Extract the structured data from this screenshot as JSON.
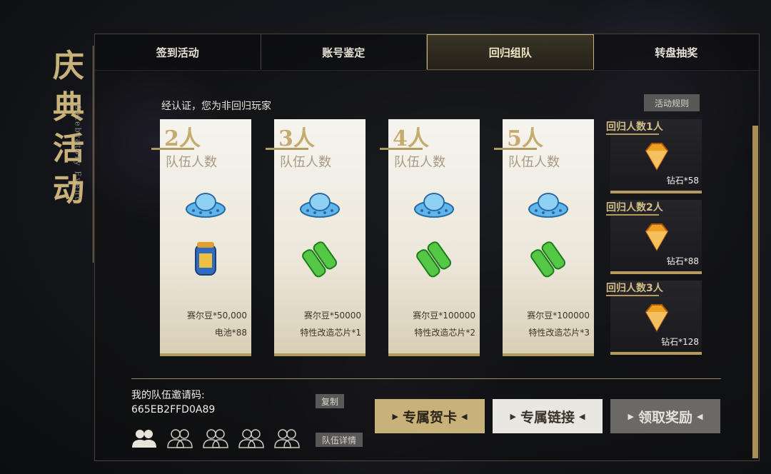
{
  "side_title": {
    "big": "庆典活动",
    "small": "Celebratory Event"
  },
  "tabs": [
    {
      "label": "签到活动"
    },
    {
      "label": "账号鉴定"
    },
    {
      "label": "回归组队"
    },
    {
      "label": "转盘抽奖"
    }
  ],
  "status_text": "经认证，您为非回归玩家",
  "rules_button": "活动规则",
  "cards": [
    {
      "num": "2人",
      "sub": "队伍人数",
      "line1": "赛尔豆*50,000",
      "line2": "电池*88",
      "icon2": "battery-icon"
    },
    {
      "num": "3人",
      "sub": "队伍人数",
      "line1": "赛尔豆*50000",
      "line2": "特性改造芯片*1",
      "icon2": "chip-icon"
    },
    {
      "num": "4人",
      "sub": "队伍人数",
      "line1": "赛尔豆*100000",
      "line2": "特性改造芯片*2",
      "icon2": "chip-icon"
    },
    {
      "num": "5人",
      "sub": "队伍人数",
      "line1": "赛尔豆*100000",
      "line2": "特性改造芯片*3",
      "icon2": "chip-icon"
    }
  ],
  "rewards": [
    {
      "title": "回归人数1人",
      "qty": "钻石*58"
    },
    {
      "title": "回归人数2人",
      "qty": "钻石*88"
    },
    {
      "title": "回归人数3人",
      "qty": "钻石*128"
    }
  ],
  "invite": {
    "label": "我的队伍邀请码:",
    "code": "665EB2FFD0A89",
    "copy": "复制",
    "details": "队伍详情"
  },
  "buttons": {
    "card": "专属贺卡",
    "link": "专属链接",
    "claim": "领取奖励"
  },
  "colors": {
    "gold": "#c9b27a",
    "card_bg": "#f6f4ee",
    "dark": "#16181d"
  }
}
